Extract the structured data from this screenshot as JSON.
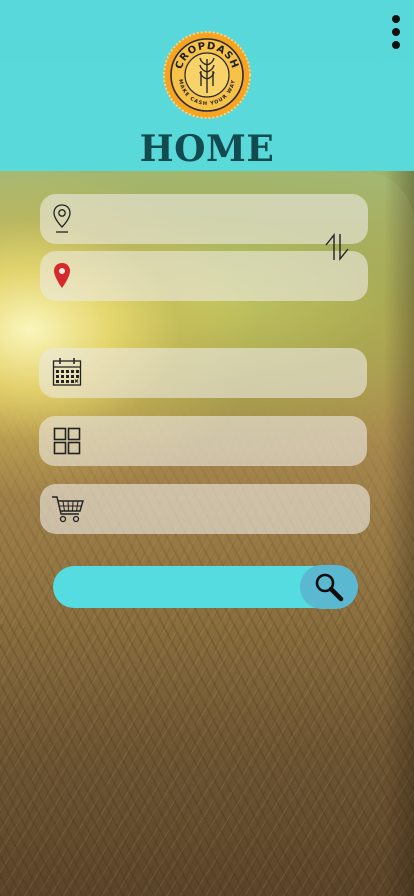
{
  "app": {
    "title": "HOME",
    "logo": {
      "name": "CROPDASH",
      "tagline": "MAKE CASH YOUR WAY",
      "icon": "wheat-badge-logo"
    }
  },
  "header": {
    "menu_icon": "more-vertical-icon",
    "background_color": "#54dce1"
  },
  "form": {
    "from_location": {
      "icon": "location-outline-icon",
      "value": "",
      "placeholder": ""
    },
    "to_location": {
      "icon": "location-pin-red-icon",
      "value": "",
      "placeholder": ""
    },
    "swap_icon": "swap-vertical-arrows-icon",
    "date": {
      "icon": "calendar-icon",
      "value": "",
      "placeholder": ""
    },
    "category": {
      "icon": "grid-icon",
      "value": "",
      "placeholder": ""
    },
    "cart": {
      "icon": "shopping-cart-icon",
      "value": "",
      "placeholder": ""
    }
  },
  "search": {
    "label": "",
    "icon": "search-icon",
    "bar_color": "#54dce1",
    "button_color": "#5ab8d0"
  }
}
